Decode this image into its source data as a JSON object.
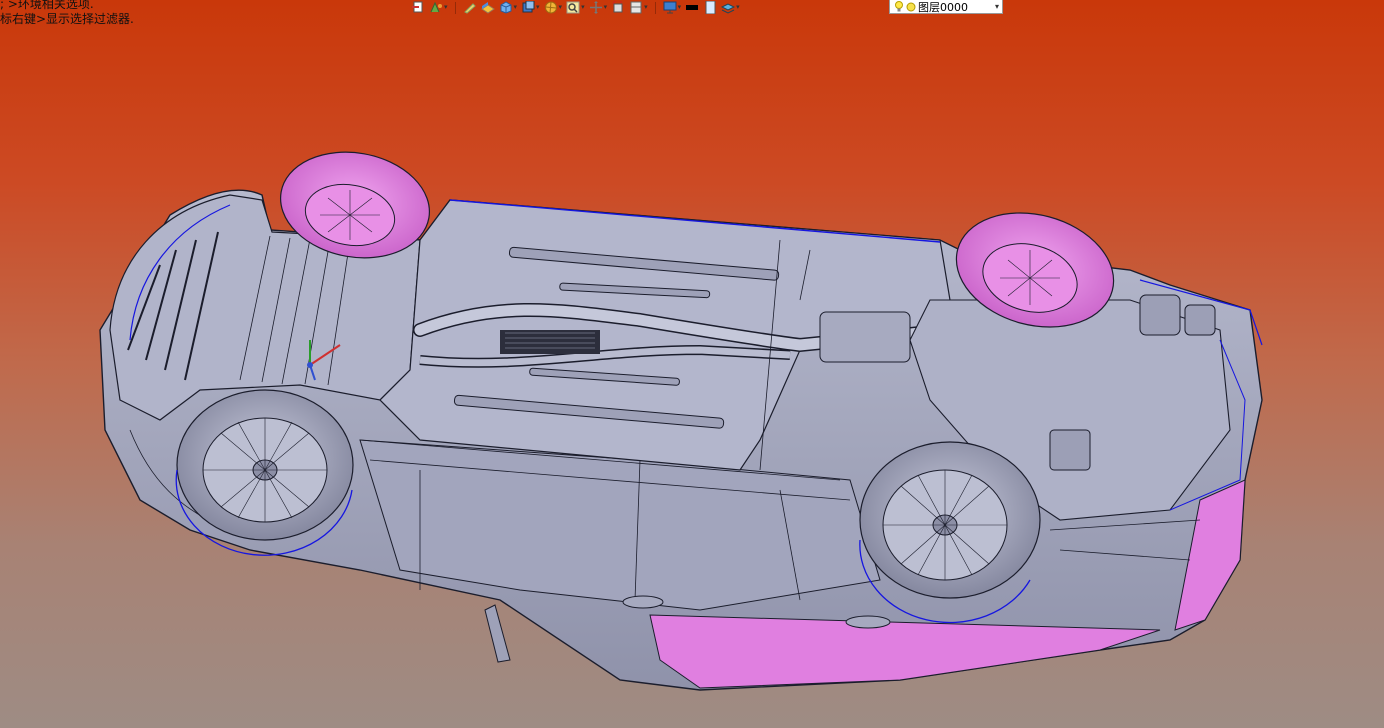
{
  "status": {
    "line1": "; >环境相关选项.",
    "line2": "标右键>显示选择过滤器."
  },
  "layer": {
    "name": "图层0000"
  },
  "colors": {
    "body_fill": "#a9acc4",
    "edge": "#1b1d2c",
    "selected_edge": "#1616e0",
    "highlight": "#e07fe0"
  },
  "toolbar_icons": [
    "import-icon",
    "measure-icon",
    "pencil-icon",
    "shading-icon",
    "cube-icon",
    "view-cube-icon",
    "render-sphere-icon",
    "zoom-icon",
    "pan-icon",
    "rotate-icon",
    "section-icon",
    "display-icon",
    "color-swatch-icon",
    "paper-icon",
    "layer-stack-icon"
  ]
}
